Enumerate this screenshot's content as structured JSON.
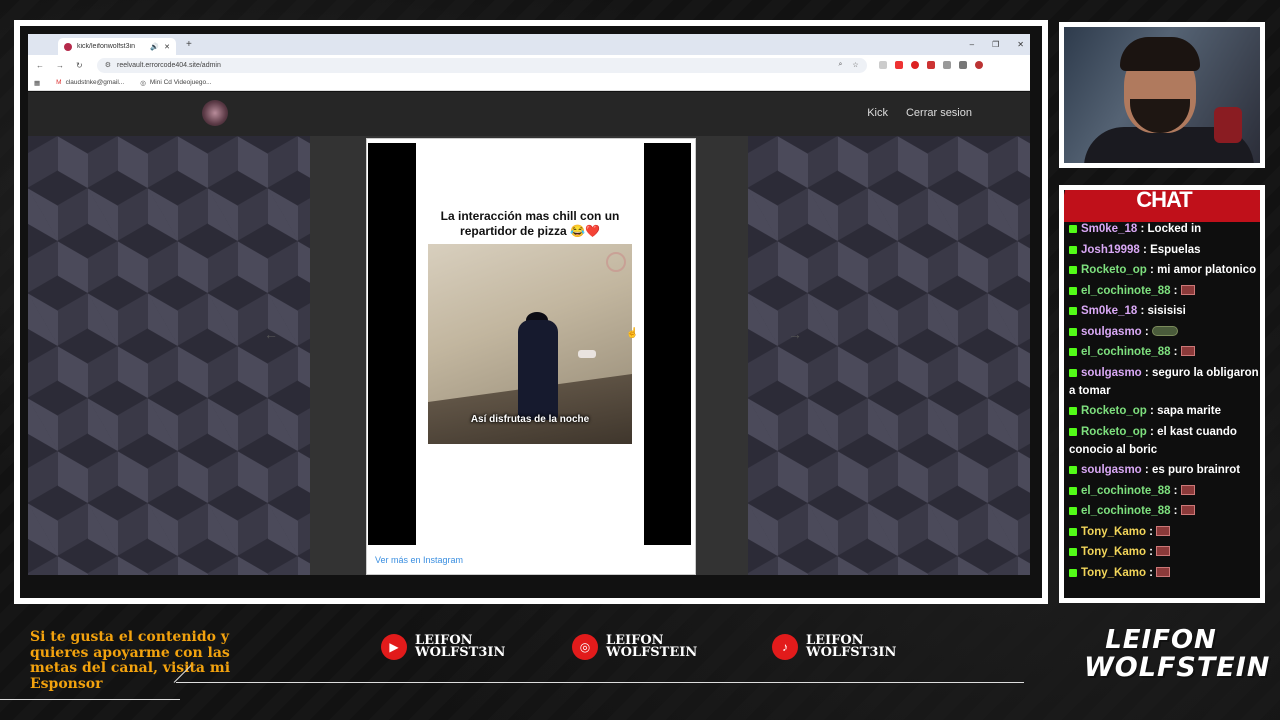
{
  "browser": {
    "tab_title": "kick/leifonwolfst3in",
    "url": "reelvault.errorcode404.site/admin",
    "bookmarks": [
      "claudstnke@gmail...",
      "Mini Cd Videojuego..."
    ]
  },
  "site": {
    "nav": [
      "Kick",
      "Cerrar sesion"
    ],
    "post": {
      "caption": "La interacción mas chill con un repartidor de pizza 😂❤️",
      "subtitle": "Así disfrutas de la noche",
      "link": "Ver más en Instagram"
    }
  },
  "chat": {
    "title": "CHAT",
    "messages": [
      {
        "user": "Sm0ke_18",
        "text": "Locked in",
        "color": "#d9a8f5"
      },
      {
        "user": "Josh19998",
        "text": "Espuelas",
        "color": "#d9a8f5"
      },
      {
        "user": "Rocketo_op",
        "text": "mi amor platonico",
        "color": "#7ee07e"
      },
      {
        "user": "el_cochinote_88",
        "text": "",
        "color": "#7ee07e",
        "emote": true
      },
      {
        "user": "Sm0ke_18",
        "text": "sisisisi",
        "color": "#d9a8f5"
      },
      {
        "user": "soulgasmo",
        "text": "",
        "color": "#d9a8f5",
        "emote": "tank"
      },
      {
        "user": "el_cochinote_88",
        "text": "",
        "color": "#7ee07e",
        "emote": true
      },
      {
        "user": "soulgasmo",
        "text": "seguro la obligaron a tomar",
        "color": "#d9a8f5"
      },
      {
        "user": "Rocketo_op",
        "text": "sapa marite",
        "color": "#7ee07e"
      },
      {
        "user": "Rocketo_op",
        "text": "el kast cuando conocio al boric",
        "color": "#7ee07e"
      },
      {
        "user": "soulgasmo",
        "text": "es puro brainrot",
        "color": "#d9a8f5"
      },
      {
        "user": "el_cochinote_88",
        "text": "",
        "color": "#7ee07e",
        "emote": true
      },
      {
        "user": "el_cochinote_88",
        "text": "",
        "color": "#7ee07e",
        "emote": true
      },
      {
        "user": "Tony_Kamo",
        "text": "",
        "color": "#f2d55a",
        "emote": true
      },
      {
        "user": "Tony_Kamo",
        "text": "",
        "color": "#f2d55a",
        "emote": true
      },
      {
        "user": "Tony_Kamo",
        "text": "",
        "color": "#f2d55a",
        "emote": true
      }
    ]
  },
  "footer": {
    "sponsor_text": "Si te gusta el contenido y quieres apoyarme con las metas del canal, visita mi Esponsor",
    "socials": [
      {
        "icon": "youtube-icon",
        "name_line1": "LEIFON",
        "name_line2": "WOLFST3IN"
      },
      {
        "icon": "instagram-icon",
        "name_line1": "LEIFON",
        "name_line2": "WOLFSTEIN"
      },
      {
        "icon": "tiktok-icon",
        "name_line1": "LEIFON",
        "name_line2": "WOLFST3IN"
      }
    ],
    "brand_line1": "LEIFON",
    "brand_line2": "WOLFSTEIN"
  },
  "colors": {
    "accent": "#c0101a",
    "sponsor_text": "#f2a20e",
    "kick_green": "#53fc18"
  }
}
